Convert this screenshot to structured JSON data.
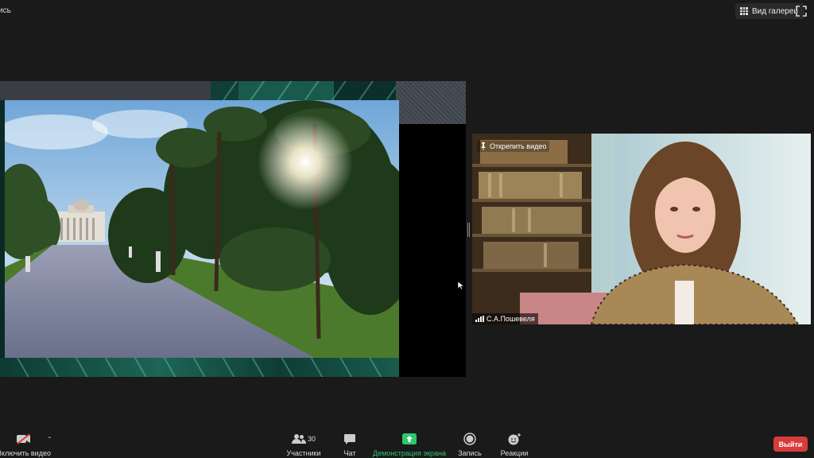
{
  "top": {
    "left_text": "ись",
    "gallery_view_label": "Вид галереи"
  },
  "video": {
    "unpin_label": "Открепить видео",
    "participant_name": "С.А.Пошевеля"
  },
  "toolbar": {
    "video_label": "Включить видео",
    "participants_label": "Участники",
    "participants_count": "30",
    "chat_label": "Чат",
    "share_label": "Демонстрация экрана",
    "record_label": "Запись",
    "reactions_label": "Реакции",
    "leave_label": "Выйти"
  },
  "colors": {
    "share_green": "#2dc86e",
    "leave_red": "#d93b3b",
    "background": "#1a1a1a"
  },
  "icons": [
    "grid-icon",
    "fullscreen-icon",
    "pin-icon",
    "signal-icon",
    "video-off-icon",
    "participants-icon",
    "chat-icon",
    "share-screen-icon",
    "record-icon",
    "reactions-icon"
  ]
}
